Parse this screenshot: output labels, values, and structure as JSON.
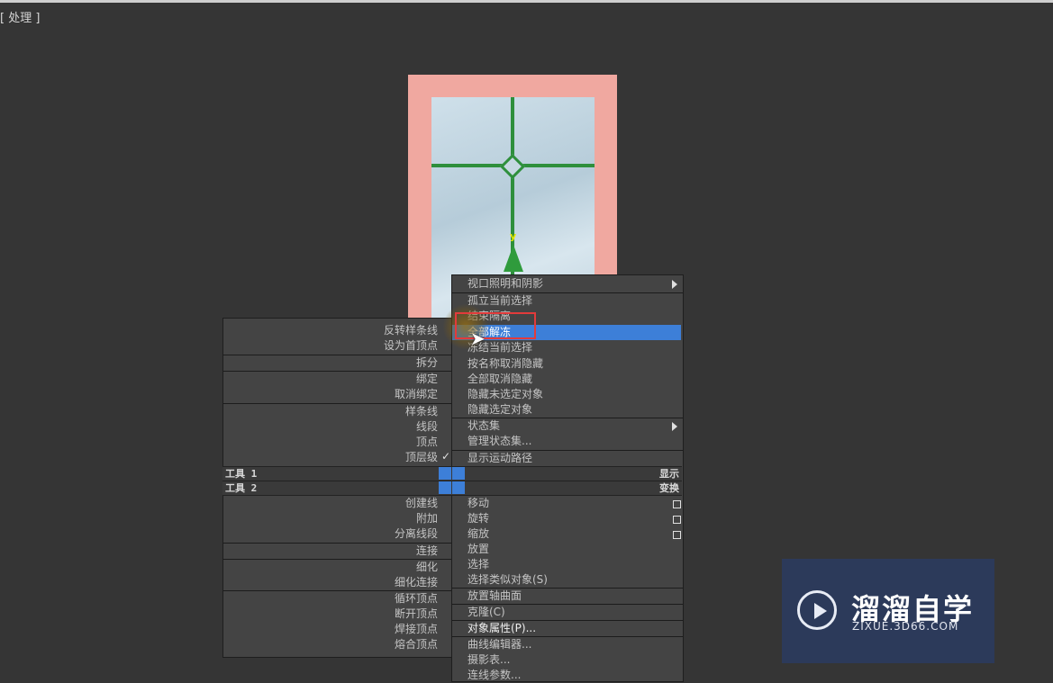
{
  "viewport": {
    "label": "[ 处理 ]"
  },
  "gizmo": {
    "axis": "y"
  },
  "left_quad": {
    "items": [
      "反转样条线",
      "设为首顶点",
      "拆分",
      "绑定",
      "取消绑定",
      "样条线",
      "线段",
      "顶点",
      "顶层级",
      "创建线",
      "附加",
      "分离线段",
      "连接",
      "细化",
      "细化连接",
      "循环顶点",
      "断开顶点",
      "焊接顶点",
      "熔合顶点"
    ],
    "checked_mark": "✓"
  },
  "right_quad": {
    "items": [
      "视口照明和阴影",
      "孤立当前选择",
      "结束隔离",
      "全部解冻",
      "冻结当前选择",
      "按名称取消隐藏",
      "全部取消隐藏",
      "隐藏未选定对象",
      "隐藏选定对象",
      "状态集",
      "管理状态集...",
      "显示运动路径",
      "移动",
      "旋转",
      "缩放",
      "放置",
      "选择",
      "选择类似对象(S)",
      "放置轴曲面",
      "克隆(C)",
      "对象属性(P)...",
      "曲线编辑器...",
      "摄影表...",
      "连线参数..."
    ]
  },
  "tools": {
    "tools1_label": "工具 1",
    "tools2_label": "工具 2",
    "display_label": "显示",
    "transform_label": "变换"
  },
  "watermark": {
    "title": "溜溜自学",
    "subtitle": "ZIXUE.3D66.COM"
  },
  "colors": {
    "highlight": "#3d7fd8",
    "annotation_box": "#e23b3b",
    "door_frame": "#f0a8a0",
    "mullion": "#2e8f3c",
    "watermark_bg": "#2c3a5a"
  }
}
